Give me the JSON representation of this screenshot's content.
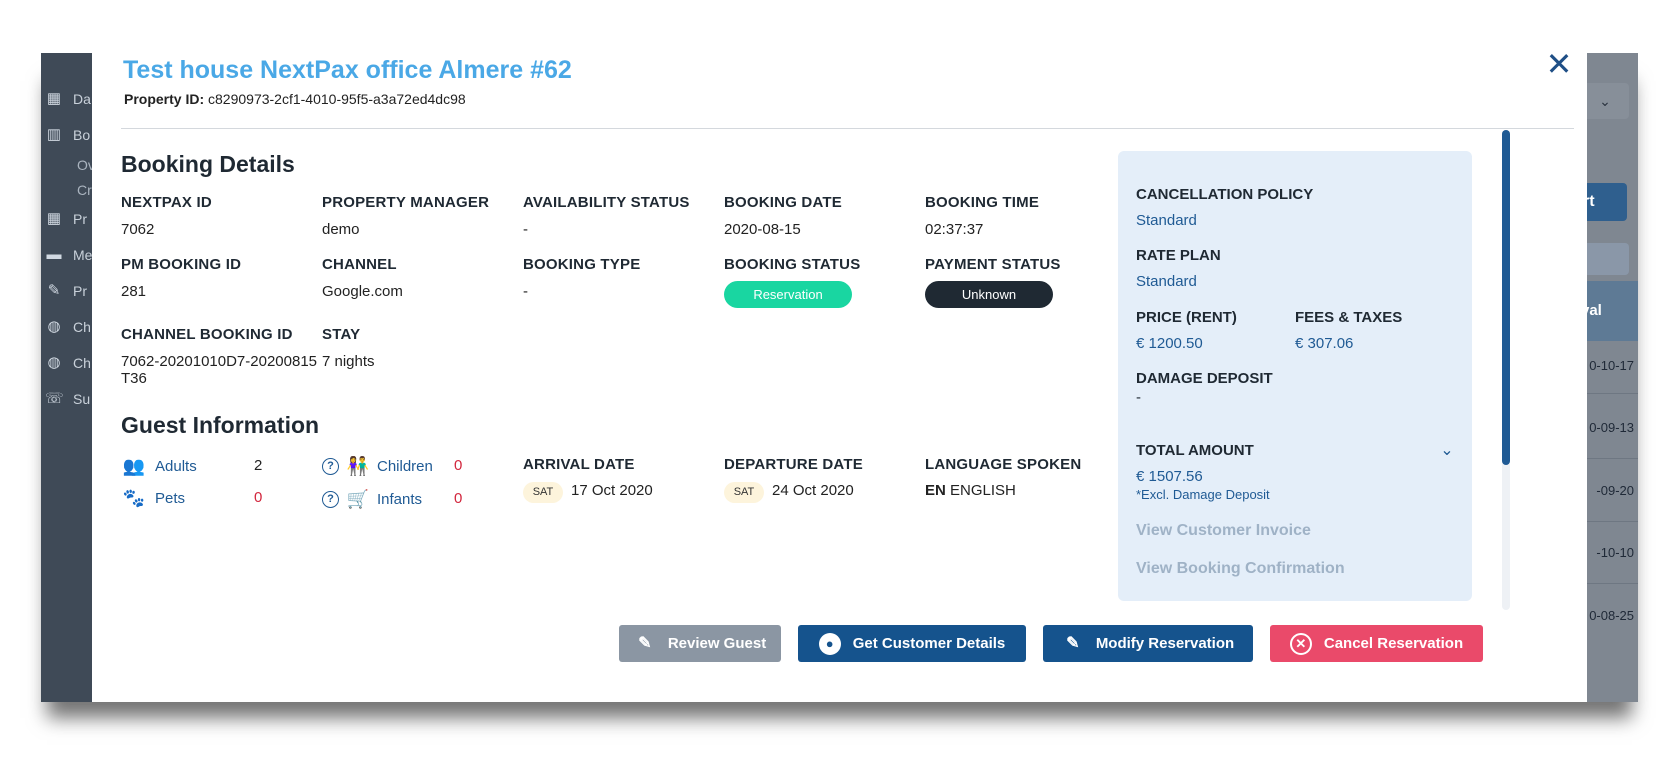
{
  "background": {
    "sidebar": [
      {
        "icon": "dashboard-icon",
        "glyph": "▦",
        "label": "Da"
      },
      {
        "icon": "book-icon",
        "glyph": "▥",
        "label": "Bo"
      },
      {
        "icon": "building-icon",
        "glyph": "▦",
        "label": "Pr"
      },
      {
        "icon": "message-icon",
        "glyph": "▬",
        "label": "Me"
      },
      {
        "icon": "wrench-icon",
        "glyph": "✎",
        "label": "Pr"
      },
      {
        "icon": "globe-icon",
        "glyph": "◍",
        "label": "Ch"
      },
      {
        "icon": "globe-icon",
        "glyph": "◍",
        "label": "Ch"
      },
      {
        "icon": "phone-icon",
        "glyph": "☏",
        "label": "Su"
      }
    ],
    "sidebar_sub": [
      "Ov",
      "Cr"
    ],
    "right_button": "rt",
    "right_header": "val",
    "right_rows": [
      "0-10-17",
      "0-09-13",
      "-09-20",
      "-10-10",
      "0-08-25"
    ]
  },
  "modal": {
    "title": "Test house NextPax office Almere #62",
    "property_id_label": "Property ID:",
    "property_id": "c8290973-2cf1-4010-95f5-a3a72ed4dc98",
    "close_glyph": "✕"
  },
  "booking": {
    "section_title": "Booking Details",
    "nextpax_id_label": "NEXTPAX ID",
    "nextpax_id": "7062",
    "property_manager_label": "PROPERTY MANAGER",
    "property_manager": "demo",
    "availability_status_label": "AVAILABILITY STATUS",
    "availability_status": "-",
    "booking_date_label": "BOOKING DATE",
    "booking_date": "2020-08-15",
    "booking_time_label": "BOOKING TIME",
    "booking_time": "02:37:37",
    "pm_booking_id_label": "PM BOOKING ID",
    "pm_booking_id": "281",
    "channel_label": "CHANNEL",
    "channel": "Google.com",
    "booking_type_label": "BOOKING TYPE",
    "booking_type": "-",
    "booking_status_label": "BOOKING STATUS",
    "booking_status": "Reservation",
    "payment_status_label": "PAYMENT STATUS",
    "payment_status": "Unknown",
    "channel_booking_id_label": "CHANNEL BOOKING ID",
    "channel_booking_id": "7062-20201010D7-20200815T36",
    "stay_label": "STAY",
    "stay": "7 nights"
  },
  "guest": {
    "section_title": "Guest Information",
    "adults_label": "Adults",
    "adults": "2",
    "pets_label": "Pets",
    "pets": "0",
    "children_label": "Children",
    "children": "0",
    "infants_label": "Infants",
    "infants": "0",
    "help_glyph": "?",
    "arrival_label": "ARRIVAL DATE",
    "arrival_day": "SAT",
    "arrival_date": "17 Oct 2020",
    "departure_label": "DEPARTURE DATE",
    "departure_day": "SAT",
    "departure_date": "24 Oct 2020",
    "language_label": "LANGUAGE SPOKEN",
    "language_code": "EN",
    "language": "ENGLISH"
  },
  "summary": {
    "cancellation_policy_label": "CANCELLATION POLICY",
    "cancellation_policy": "Standard",
    "rate_plan_label": "RATE PLAN",
    "rate_plan": "Standard",
    "price_label": "PRICE (RENT)",
    "price": "€ 1200.50",
    "fees_label": "FEES & TAXES",
    "fees": "€ 307.06",
    "damage_deposit_label": "DAMAGE DEPOSIT",
    "damage_deposit": "-",
    "total_label": "TOTAL AMOUNT",
    "total": "€ 1507.56",
    "total_note": "*Excl. Damage Deposit",
    "invoice_link": "View Customer Invoice",
    "confirmation_link": "View Booking Confirmation"
  },
  "actions": {
    "review_guest": "Review Guest",
    "get_customer_details": "Get Customer Details",
    "modify_reservation": "Modify Reservation",
    "cancel_reservation": "Cancel Reservation"
  },
  "colors": {
    "title": "#4aa8e6",
    "navy": "#15538d",
    "reservation_pill": "#19d6a1",
    "unknown_pill": "#1f2933",
    "cancel_button": "#ea4a6a",
    "review_button": "#8b96a3",
    "summary_bg": "#e4eef9"
  }
}
